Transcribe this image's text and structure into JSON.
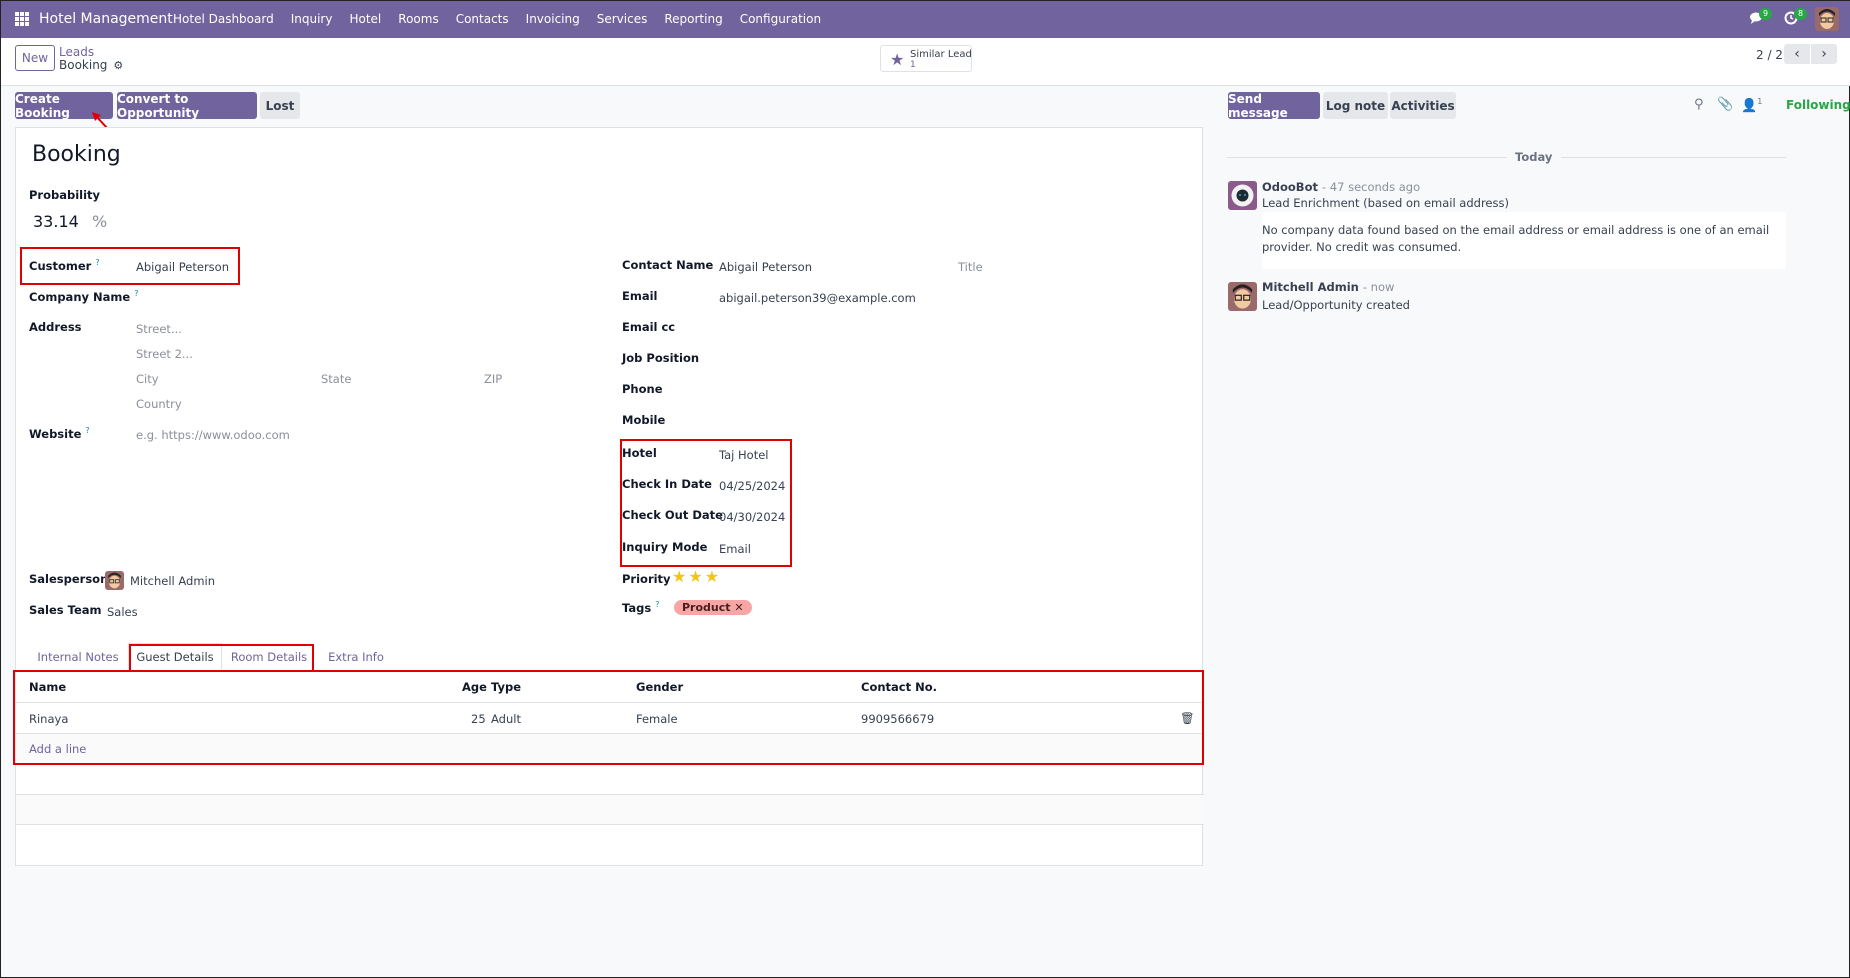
{
  "navbar": {
    "app_name": "Hotel Management",
    "menu": [
      "Hotel Dashboard",
      "Inquiry",
      "Hotel",
      "Rooms",
      "Contacts",
      "Invoicing",
      "Services",
      "Reporting",
      "Configuration"
    ],
    "messages_badge": "9",
    "activities_badge": "8",
    "brand_color": "#71639e"
  },
  "control_panel": {
    "new_label": "New",
    "breadcrumb_parent": "Leads",
    "breadcrumb_current": "Booking",
    "smart_button": {
      "label": "Similar Lead",
      "count": "1"
    },
    "pager": "2 / 2"
  },
  "status_bar": {
    "create_booking": "Create Booking",
    "convert": "Convert to Opportunity",
    "lost": "Lost"
  },
  "form": {
    "title": "Booking",
    "probability_label": "Probability",
    "probability_value": "33.14",
    "probability_unit": "%",
    "left": {
      "customer_label": "Customer",
      "customer_value": "Abigail Peterson",
      "company_label": "Company Name",
      "address_label": "Address",
      "street_ph": "Street...",
      "street2_ph": "Street 2...",
      "city_ph": "City",
      "state_ph": "State",
      "zip_ph": "ZIP",
      "country_ph": "Country",
      "website_label": "Website",
      "website_ph": "e.g. https://www.odoo.com",
      "salesperson_label": "Salesperson",
      "salesperson_value": "Mitchell Admin",
      "sales_team_label": "Sales Team",
      "sales_team_value": "Sales"
    },
    "right": {
      "contact_name_label": "Contact Name",
      "contact_name_value": "Abigail Peterson",
      "title_ph": "Title",
      "email_label": "Email",
      "email_value": "abigail.peterson39@example.com",
      "email_cc_label": "Email cc",
      "job_position_label": "Job Position",
      "phone_label": "Phone",
      "mobile_label": "Mobile",
      "hotel_label": "Hotel",
      "hotel_value": "Taj Hotel",
      "check_in_label": "Check In Date",
      "check_in_value": "04/25/2024",
      "check_out_label": "Check Out Date",
      "check_out_value": "04/30/2024",
      "inquiry_mode_label": "Inquiry Mode",
      "inquiry_mode_value": "Email",
      "priority_label": "Priority",
      "priority_stars": 3,
      "priority_max": 3,
      "tags_label": "Tags",
      "tag": "Product"
    },
    "tabs": [
      "Internal Notes",
      "Guest Details",
      "Room Details",
      "Extra Info"
    ],
    "active_tab": "Guest Details",
    "guest_table": {
      "columns": [
        "Name",
        "Age",
        "Type",
        "Gender",
        "Contact No."
      ],
      "rows": [
        {
          "name": "Rinaya",
          "age": "25",
          "type": "Adult",
          "gender": "Female",
          "contact": "9909566679"
        }
      ],
      "add_line": "Add a line"
    }
  },
  "chatter": {
    "send_message": "Send message",
    "log_note": "Log note",
    "activities": "Activities",
    "followers_count": "1",
    "following": "Following",
    "date_separator": "Today",
    "messages": [
      {
        "author": "OdooBot",
        "time": "- 47 seconds ago",
        "subject": "Lead Enrichment (based on email address)",
        "body": "No company data found based on the email address or email address is one of an email provider. No credit was consumed."
      },
      {
        "author": "Mitchell Admin",
        "time": "- now",
        "subject": "Lead/Opportunity created"
      }
    ]
  }
}
